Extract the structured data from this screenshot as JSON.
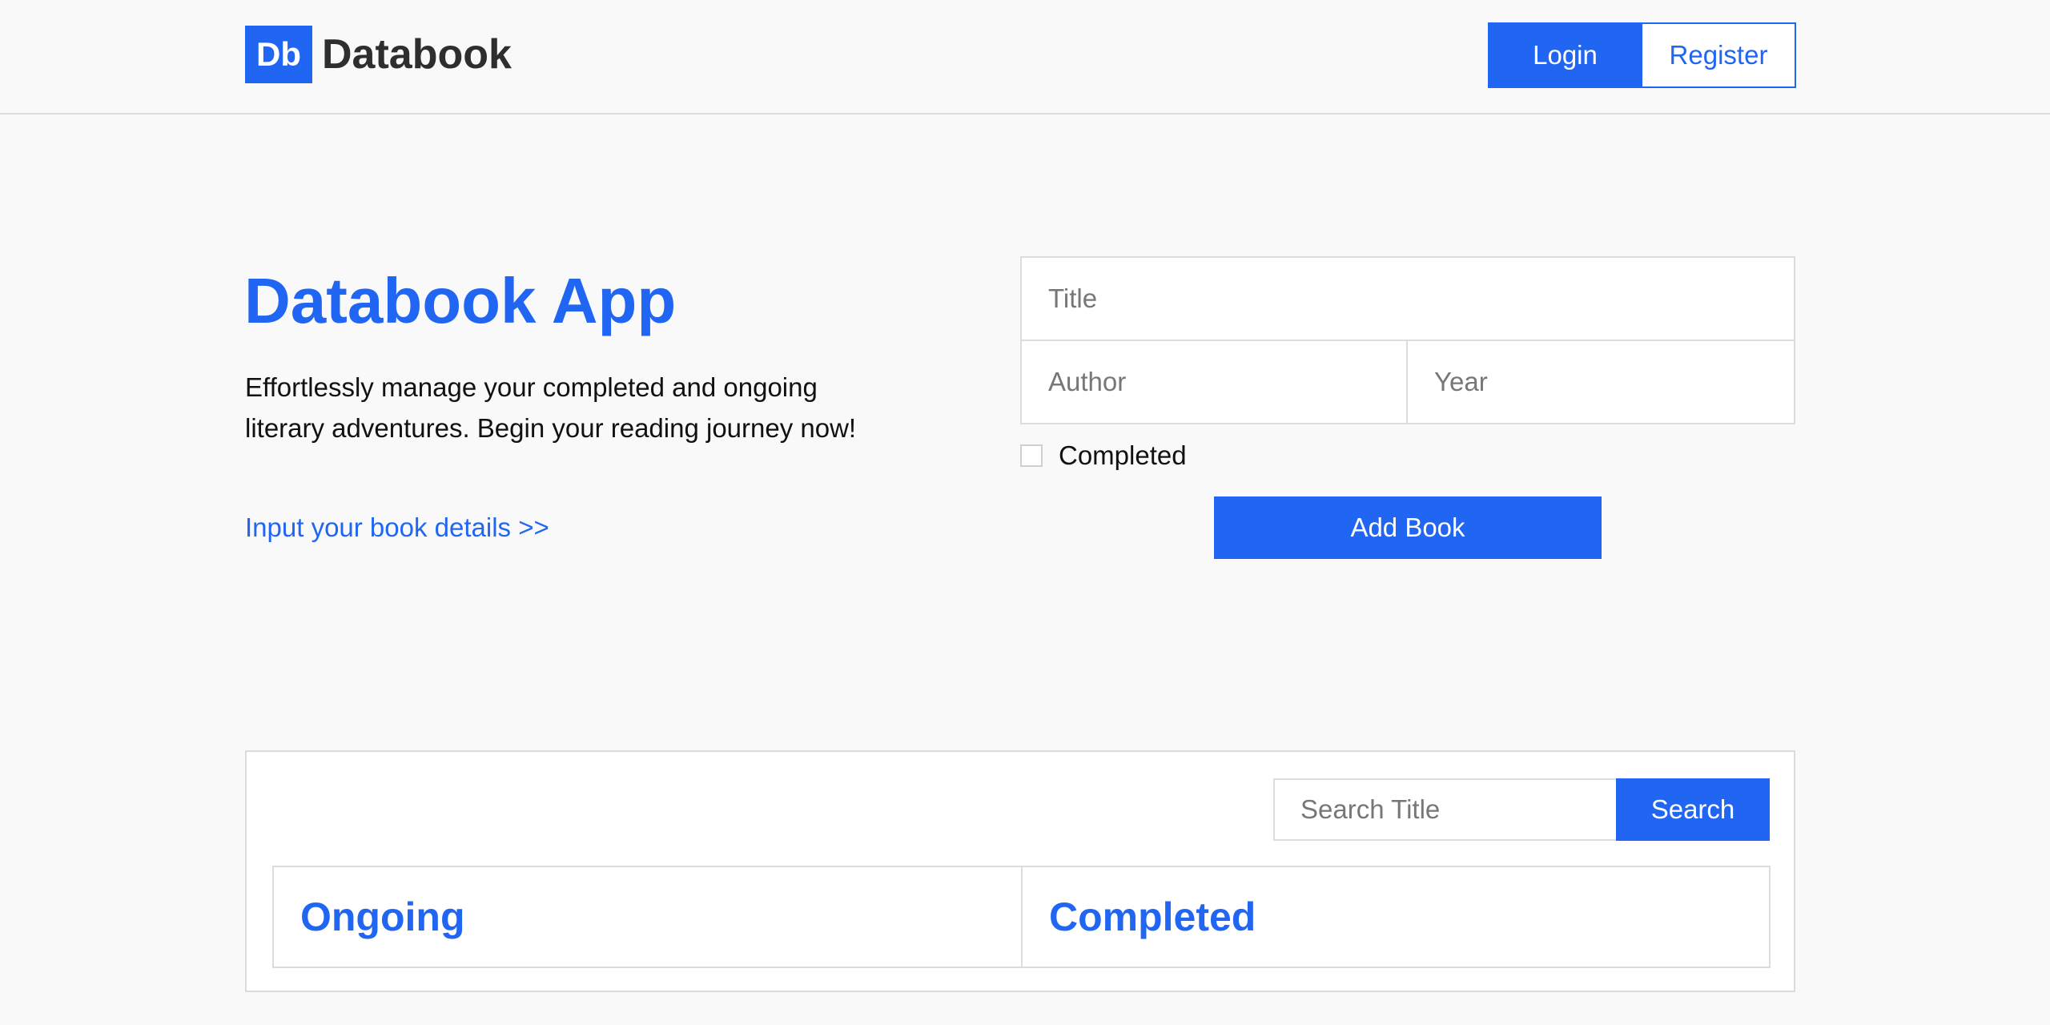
{
  "header": {
    "logo_badge": "Db",
    "logo_name": "Databook",
    "login_label": "Login",
    "register_label": "Register"
  },
  "hero": {
    "title": "Databook App",
    "description": "Effortlessly manage your completed and ongoing literary adventures. Begin your reading journey now!",
    "link": "Input your book details >>"
  },
  "form": {
    "title_placeholder": "Title",
    "author_placeholder": "Author",
    "year_placeholder": "Year",
    "completed_label": "Completed",
    "completed_checked": false,
    "add_label": "Add Book"
  },
  "books": {
    "search_placeholder": "Search Title",
    "search_label": "Search",
    "ongoing_title": "Ongoing",
    "completed_title": "Completed"
  },
  "colors": {
    "accent": "#2166f3",
    "background": "#f9f9f9",
    "border": "#dcdcdc"
  }
}
